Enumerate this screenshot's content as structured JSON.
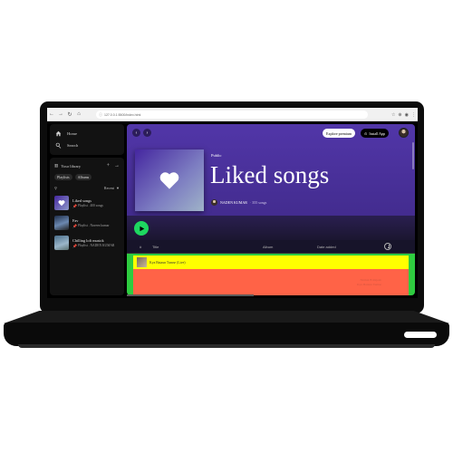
{
  "browser": {
    "url": "127.0.0.1:5500/index.html",
    "back_icon": "arrow-left-icon",
    "forward_icon": "arrow-right-icon",
    "reload_icon": "reload-icon"
  },
  "sidebar": {
    "nav": [
      {
        "label": "Home",
        "icon": "home-icon"
      },
      {
        "label": "Search",
        "icon": "search-icon"
      }
    ],
    "library": {
      "title": "Your library",
      "add": "+",
      "expand": "→",
      "chips": [
        "Playlists",
        "Albums"
      ],
      "sort_label": "Recent",
      "items": [
        {
          "title": "Liked songs",
          "subtitle": "Playlist . 400 songs"
        },
        {
          "title": "Fav",
          "subtitle": "Playlist . Naveen kumar"
        },
        {
          "title": "Chilling lofi musick",
          "subtitle": "Playlist . NADEN KUMAR"
        }
      ]
    }
  },
  "header": {
    "explore_label": "Explore premium",
    "install_label": "Install App"
  },
  "playlist": {
    "type": "Public",
    "title": "Liked songs",
    "owner": "NADEN KUMAR",
    "song_count": "· 355 songs"
  },
  "table": {
    "columns": {
      "index": "#",
      "title": "Title",
      "album": "Album",
      "date_added": "Date added"
    },
    "rows": [
      {
        "title": "Kya Bataun Tumse (Live)"
      }
    ],
    "ghost_text_1": "Nirmal B Rajesh",
    "ghost_text_2": "Kya Bataun Tumse"
  },
  "colors": {
    "accent": "#1ed760",
    "hero": "#5136a8",
    "row_highlight": "#ffff00",
    "row_bg": "#ff6347",
    "table_bg": "#2ecc40"
  }
}
